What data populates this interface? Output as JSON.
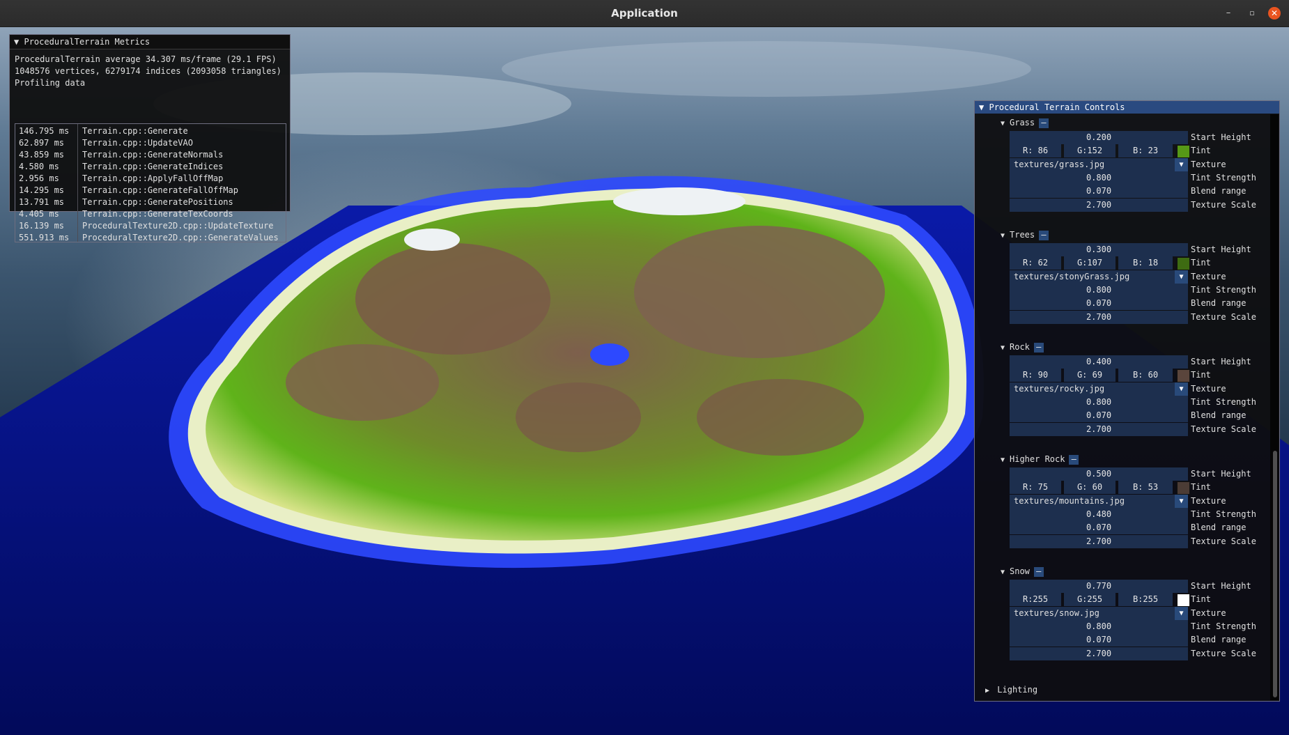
{
  "window": {
    "title": "Application",
    "minimize": "–",
    "maximize": "▫",
    "close": "✕"
  },
  "metrics": {
    "header": "ProceduralTerrain Metrics",
    "fps_line": "ProceduralTerrain average 34.307 ms/frame (29.1 FPS)",
    "mesh_line": "1048576 vertices, 6279174 indices (2093058 triangles)",
    "profiling_label": "Profiling data",
    "rows": [
      {
        "ms": "146.795 ms",
        "fn": "Terrain.cpp::Generate"
      },
      {
        "ms": "62.897 ms",
        "fn": "Terrain.cpp::UpdateVAO"
      },
      {
        "ms": "43.859 ms",
        "fn": "Terrain.cpp::GenerateNormals"
      },
      {
        "ms": "4.580 ms",
        "fn": "Terrain.cpp::GenerateIndices"
      },
      {
        "ms": "2.956 ms",
        "fn": "Terrain.cpp::ApplyFallOffMap"
      },
      {
        "ms": "14.295 ms",
        "fn": "Terrain.cpp::GenerateFallOffMap"
      },
      {
        "ms": "13.791 ms",
        "fn": "Terrain.cpp::GeneratePositions"
      },
      {
        "ms": "4.405 ms",
        "fn": "Terrain.cpp::GenerateTexCoords"
      },
      {
        "ms": "16.139 ms",
        "fn": "ProceduralTexture2D.cpp::UpdateTexture"
      },
      {
        "ms": "551.913 ms",
        "fn": "ProceduralTexture2D.cpp::GenerateValues"
      }
    ]
  },
  "controls": {
    "header": "Procedural Terrain Controls",
    "labels": {
      "start_height": "Start Height",
      "tint": "Tint",
      "texture": "Texture",
      "tint_strength": "Tint Strength",
      "blend_range": "Blend range",
      "texture_scale": "Texture Scale"
    },
    "minus": "–",
    "sections": [
      {
        "name": "Grass",
        "start_height": "0.200",
        "r": "R: 86",
        "g": "G:152",
        "b": "B: 23",
        "tint_color": "#569817",
        "texture": "textures/grass.jpg",
        "tint_strength": "0.800",
        "blend_range": "0.070",
        "texture_scale": "2.700"
      },
      {
        "name": "Trees",
        "start_height": "0.300",
        "r": "R: 62",
        "g": "G:107",
        "b": "B: 18",
        "tint_color": "#3e6b12",
        "texture": "textures/stonyGrass.jpg",
        "tint_strength": "0.800",
        "blend_range": "0.070",
        "texture_scale": "2.700"
      },
      {
        "name": "Rock",
        "start_height": "0.400",
        "r": "R: 90",
        "g": "G: 69",
        "b": "B: 60",
        "tint_color": "#5a453c",
        "texture": "textures/rocky.jpg",
        "tint_strength": "0.800",
        "blend_range": "0.070",
        "texture_scale": "2.700"
      },
      {
        "name": "Higher Rock",
        "start_height": "0.500",
        "r": "R: 75",
        "g": "G: 60",
        "b": "B: 53",
        "tint_color": "#4b3c35",
        "texture": "textures/mountains.jpg",
        "tint_strength": "0.480",
        "blend_range": "0.070",
        "texture_scale": "2.700"
      },
      {
        "name": "Snow",
        "start_height": "0.770",
        "r": "R:255",
        "g": "G:255",
        "b": "B:255",
        "tint_color": "#ffffff",
        "texture": "textures/snow.jpg",
        "tint_strength": "0.800",
        "blend_range": "0.070",
        "texture_scale": "2.700"
      }
    ],
    "lighting": "Lighting"
  },
  "colors": {
    "accent": "#2a4a80",
    "field_bg": "#1d2f4e",
    "ocean": "#05118f",
    "grass": "#63b815",
    "rock": "#7a5e4c"
  }
}
